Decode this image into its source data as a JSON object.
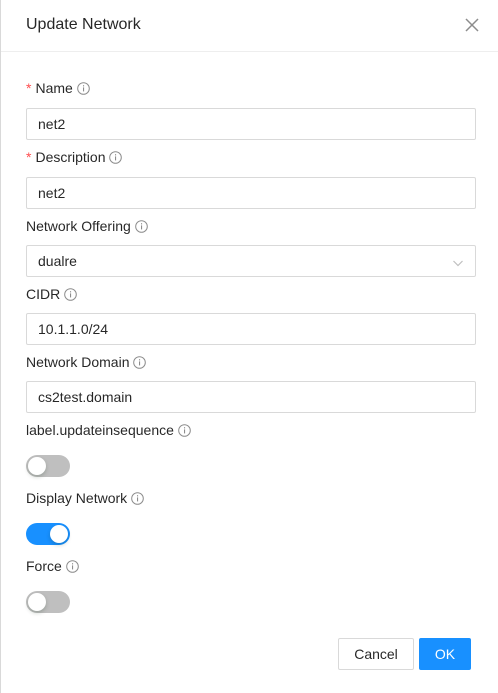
{
  "modal": {
    "title": "Update Network",
    "close_icon": "close-icon"
  },
  "form": {
    "name": {
      "label": "Name",
      "required": true,
      "value": "net2"
    },
    "description": {
      "label": "Description",
      "required": true,
      "value": "net2"
    },
    "network_offering": {
      "label": "Network Offering",
      "selected": "dualre"
    },
    "cidr": {
      "label": "CIDR",
      "value": "10.1.1.0/24"
    },
    "network_domain": {
      "label": "Network Domain",
      "value": "cs2test.domain"
    },
    "update_in_sequence": {
      "label": "label.updateinsequence",
      "on": false
    },
    "display_network": {
      "label": "Display Network",
      "on": true
    },
    "force": {
      "label": "Force",
      "on": false
    }
  },
  "footer": {
    "cancel_label": "Cancel",
    "ok_label": "OK"
  },
  "colors": {
    "primary": "#1890ff",
    "required": "#ff4d4f",
    "switch_off": "#bfbfbf",
    "border": "#d9d9d9"
  }
}
